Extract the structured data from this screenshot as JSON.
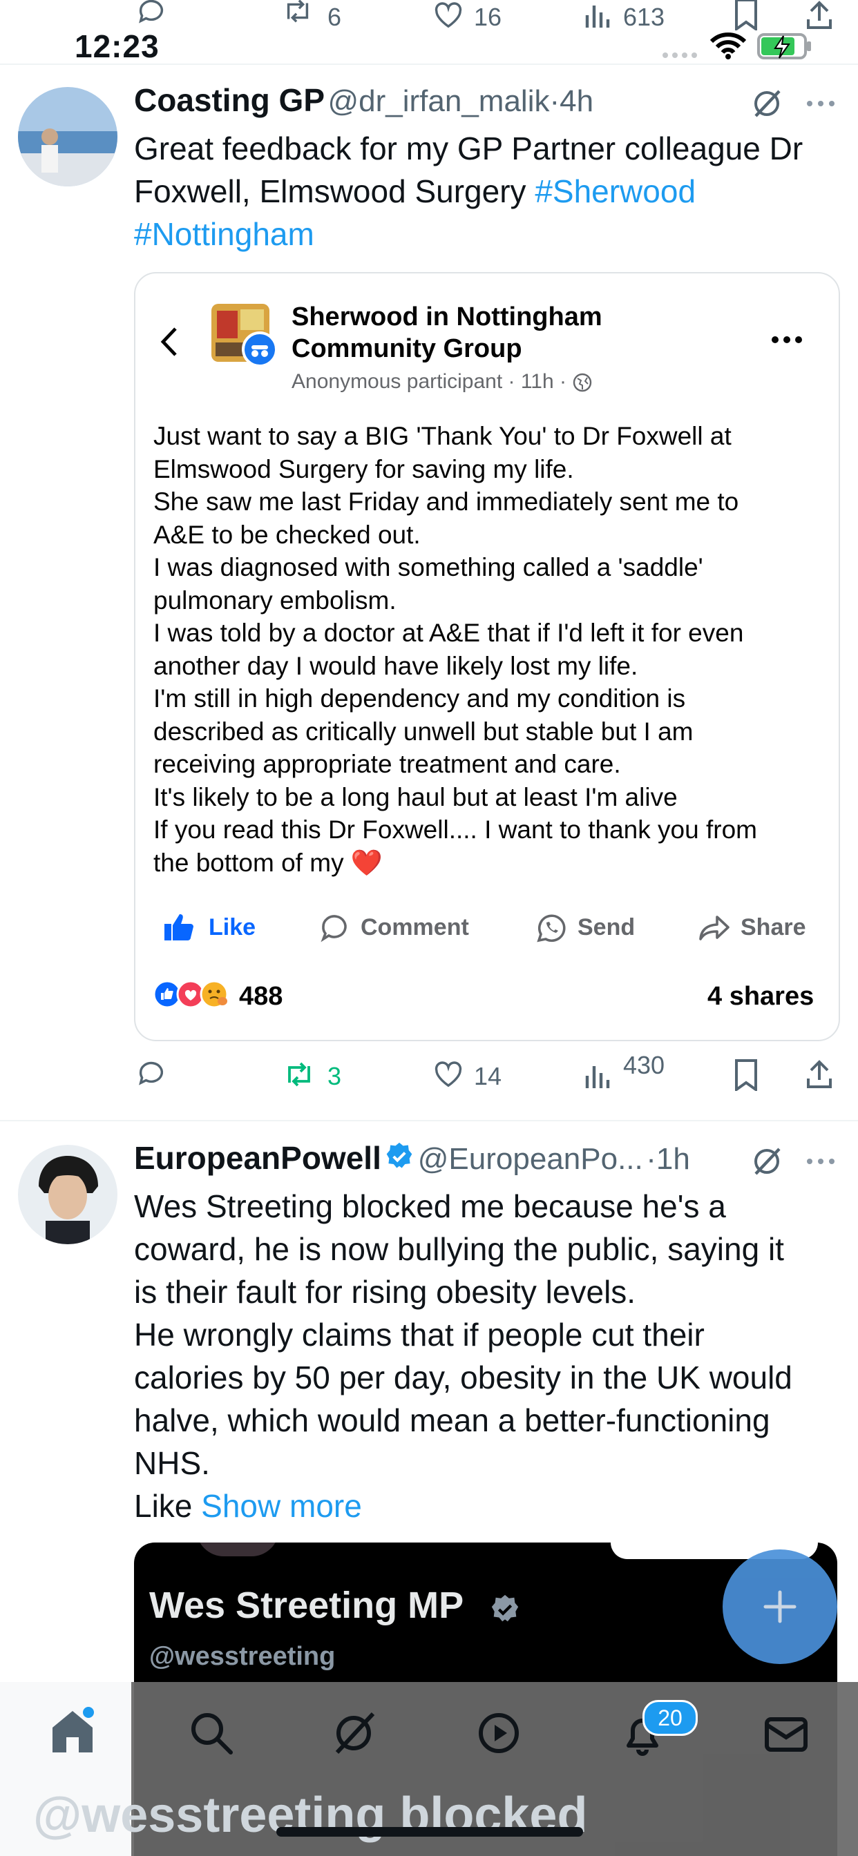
{
  "status_bar": {
    "time": "12:23"
  },
  "top_actions": {
    "retweets": "6",
    "likes": "16",
    "views": "613"
  },
  "tweet1": {
    "name": "Coasting GP",
    "handle": "@dr_irfan_malik",
    "sep": "·",
    "age": "4h",
    "text_plain": "Great feedback for my GP Partner colleague Dr Foxwell, Elmswood Surgery ",
    "hashtag1": "#Sherwood",
    "hashtag2": "#Nottingham",
    "embed": {
      "group_line1": "Sherwood in Nottingham",
      "group_line2": "Community Group",
      "meta": "Anonymous participant · 11h ·",
      "lines": [
        "Just want to say a BIG 'Thank You' to Dr Foxwell at",
        "Elmswood Surgery for saving my life.",
        "She saw me last Friday and immediately sent me to",
        "A&E to be checked out.",
        "I was diagnosed with something called a 'saddle'",
        "pulmonary embolism.",
        "I was told by a doctor at A&E that if I'd left it for even",
        "another day I would have likely lost my life.",
        "I'm still in high dependency and my condition is",
        "described as critically unwell but stable but I am",
        "receiving appropriate treatment and care.",
        "It's likely to be a long haul but at least I'm alive",
        "If you read this Dr Foxwell.... I want to thank you from",
        "the bottom of my ❤️"
      ],
      "like_label": "Like",
      "comment_label": "Comment",
      "send_label": "Send",
      "share_label": "Share",
      "reactions_count": "488",
      "shares_label": "4 shares"
    },
    "actions": {
      "retweets": "3",
      "likes": "14",
      "views": "430"
    }
  },
  "tweet2": {
    "name": "EuropeanPowell",
    "handle": "@EuropeanPo...",
    "sep": "·",
    "age": "1h",
    "lines": [
      "Wes Streeting blocked me because he's a",
      "coward, he is now bullying the public, saying it",
      "is their fault for rising obesity levels.",
      "He wrongly claims that if people cut their",
      "calories by 50 per day, obesity in the UK would",
      "halve, which would mean a better-functioning",
      "NHS."
    ],
    "last_line_prefix": "Like ",
    "show_more": "Show more",
    "embed": {
      "name": "Wes Streeting MP",
      "handle": "@wesstreeting",
      "big_text": "@wesstreeting blocked"
    }
  },
  "bottom_nav": {
    "notifications_badge": "20"
  },
  "colors": {
    "link": "#1d9bf0",
    "retweet_green": "#00ba7c",
    "fb_blue": "#0866ff",
    "fab": "#4a90d9"
  }
}
